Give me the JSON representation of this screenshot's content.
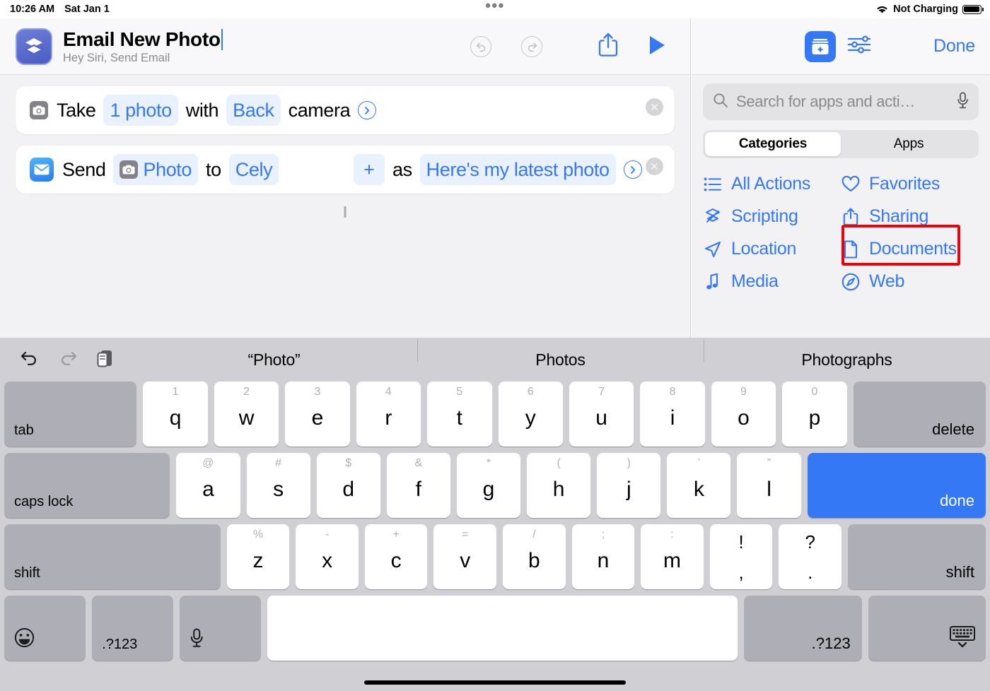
{
  "status_bar": {
    "time": "10:26 AM",
    "date": "Sat Jan 1",
    "battery_text": "Not Charging",
    "wifi_icon": "wifi-icon",
    "battery_icon": "battery-icon",
    "multitask_dots": "•••"
  },
  "editor": {
    "shortcut_icon": "shortcuts-layers-icon",
    "title": "Email New Photo",
    "subtitle": "Hey Siri, Send Email",
    "toolbar": {
      "undo_icon": "undo-icon",
      "redo_icon": "redo-icon",
      "share_icon": "share-icon",
      "play_icon": "play-icon"
    },
    "actions": [
      {
        "icon": "camera-icon",
        "parts": [
          {
            "type": "text",
            "value": "Take"
          },
          {
            "type": "token",
            "value": "1 photo"
          },
          {
            "type": "text",
            "value": "with"
          },
          {
            "type": "token",
            "value": "Back"
          },
          {
            "type": "text",
            "value": "camera"
          },
          {
            "type": "chevron",
            "value": "chevron-right-icon"
          }
        ],
        "remove_label": "×"
      },
      {
        "icon": "mail-icon",
        "parts": [
          {
            "type": "text",
            "value": "Send"
          },
          {
            "type": "token_with_icon",
            "value": "Photo",
            "icon": "camera-icon"
          },
          {
            "type": "text",
            "value": "to"
          },
          {
            "type": "token",
            "value": "Cely"
          },
          {
            "type": "plus",
            "value": "+"
          },
          {
            "type": "text",
            "value": "as"
          },
          {
            "type": "token",
            "value": "Here's my latest photo"
          },
          {
            "type": "chevron",
            "value": "chevron-right-icon"
          }
        ],
        "remove_label": "×"
      }
    ]
  },
  "right_panel": {
    "suggestions_icon": "suggestions-sparkle-icon",
    "settings_icon": "sliders-icon",
    "done_label": "Done",
    "search": {
      "placeholder": "Search for apps and acti…",
      "search_icon": "search-icon",
      "mic_icon": "microphone-icon"
    },
    "tabs": [
      {
        "label": "Categories",
        "active": true
      },
      {
        "label": "Apps",
        "active": false
      }
    ],
    "categories": [
      {
        "label": "All Actions",
        "icon": "list-bullet-icon"
      },
      {
        "label": "Favorites",
        "icon": "heart-icon"
      },
      {
        "label": "Scripting",
        "icon": "scripting-icon"
      },
      {
        "label": "Sharing",
        "icon": "share-icon",
        "highlighted": true
      },
      {
        "label": "Location",
        "icon": "location-arrow-icon"
      },
      {
        "label": "Documents",
        "icon": "document-icon"
      },
      {
        "label": "Media",
        "icon": "music-note-icon"
      },
      {
        "label": "Web",
        "icon": "compass-icon"
      }
    ],
    "highlight_color": "#e8040c"
  },
  "keyboard": {
    "toolbar": {
      "undo_icon": "undo-icon",
      "redo_icon": "redo-icon",
      "paste_icon": "paste-icon"
    },
    "predictions": [
      "“Photo”",
      "Photos",
      "Photographs"
    ],
    "rows": [
      [
        {
          "label": "tab",
          "type": "mod",
          "align": "left-bottom",
          "flex": 2.05
        },
        {
          "label": "q",
          "sub": "1",
          "flex": 1
        },
        {
          "label": "w",
          "sub": "2",
          "flex": 1
        },
        {
          "label": "e",
          "sub": "3",
          "flex": 1
        },
        {
          "label": "r",
          "sub": "4",
          "flex": 1
        },
        {
          "label": "t",
          "sub": "5",
          "flex": 1
        },
        {
          "label": "y",
          "sub": "6",
          "flex": 1
        },
        {
          "label": "u",
          "sub": "7",
          "flex": 1
        },
        {
          "label": "i",
          "sub": "8",
          "flex": 1
        },
        {
          "label": "o",
          "sub": "9",
          "flex": 1
        },
        {
          "label": "p",
          "sub": "0",
          "flex": 1
        },
        {
          "label": "delete",
          "type": "mod",
          "align": "right-center",
          "flex": 2.05
        }
      ],
      [
        {
          "label": "caps lock",
          "type": "mod",
          "align": "left-bottom",
          "flex": 2.6
        },
        {
          "label": "a",
          "sub": "@",
          "flex": 1
        },
        {
          "label": "s",
          "sub": "#",
          "flex": 1
        },
        {
          "label": "d",
          "sub": "$",
          "flex": 1
        },
        {
          "label": "f",
          "sub": "&",
          "flex": 1
        },
        {
          "label": "g",
          "sub": "*",
          "flex": 1
        },
        {
          "label": "h",
          "sub": "(",
          "flex": 1
        },
        {
          "label": "j",
          "sub": ")",
          "flex": 1
        },
        {
          "label": "k",
          "sub": "’",
          "flex": 1
        },
        {
          "label": "l",
          "sub": "”",
          "flex": 1
        },
        {
          "label": "done",
          "type": "blue",
          "align": "right-center",
          "flex": 2.8
        }
      ],
      [
        {
          "label": "shift",
          "type": "mod",
          "align": "right-center",
          "flex": 3.45
        },
        {
          "label": "z",
          "sub": "%",
          "flex": 1
        },
        {
          "label": "x",
          "sub": "-",
          "flex": 1
        },
        {
          "label": "c",
          "sub": "+",
          "flex": 1
        },
        {
          "label": "v",
          "sub": "=",
          "flex": 1
        },
        {
          "label": "b",
          "sub": "/",
          "flex": 1
        },
        {
          "label": "n",
          "sub": ";",
          "flex": 1
        },
        {
          "label": "m",
          "sub": ":",
          "flex": 1
        },
        {
          "punct_top": "!",
          "punct_bottom": ",",
          "flex": 1
        },
        {
          "punct_top": "?",
          "punct_bottom": ".",
          "flex": 1
        },
        {
          "label": "shift",
          "type": "mod",
          "align": "right-center",
          "flex": 2.2
        }
      ],
      [
        {
          "icon": "emoji-icon",
          "type": "mod",
          "align": "icon-left-bottom",
          "flex": 1.42
        },
        {
          "label": ".?123",
          "type": "mod",
          "align": "left-bottom",
          "flex": 1.42
        },
        {
          "icon": "microphone-icon",
          "type": "mod",
          "align": "icon-left-bottom",
          "flex": 1.42
        },
        {
          "label": "",
          "type": "space",
          "flex": 8.2
        },
        {
          "label": ".?123",
          "type": "mod",
          "align": "right-center",
          "flex": 2.05
        },
        {
          "icon": "hide-keyboard-icon",
          "type": "mod",
          "align": "icon-right-bottom",
          "flex": 2.05
        }
      ]
    ]
  }
}
